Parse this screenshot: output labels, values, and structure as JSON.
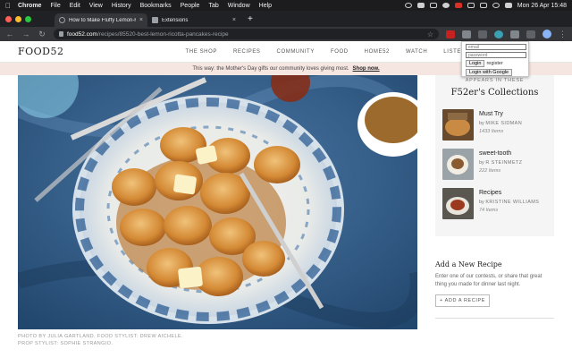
{
  "menubar": {
    "app": "Chrome",
    "items": [
      "File",
      "Edit",
      "View",
      "History",
      "Bookmarks",
      "People",
      "Tab",
      "Window",
      "Help"
    ],
    "clock": "Mon 26 Apr  15:48"
  },
  "tabs": [
    {
      "title": "How to Make Fluffy Lemon-Ric",
      "active": true
    },
    {
      "title": "Extensions",
      "active": false
    }
  ],
  "address": {
    "host": "food52.com",
    "path": "/recipes/85520-best-lemon-ricotta-pancakes-recipe"
  },
  "site": {
    "logo": "FOOD52",
    "nav": [
      "THE SHOP",
      "RECIPES",
      "COMMUNITY",
      "FOOD",
      "HOME52",
      "WATCH",
      "LISTEN"
    ]
  },
  "banner": {
    "text": "This way: the Mother's Day gifts our community loves giving most.",
    "link": "Shop now."
  },
  "photo": {
    "credit_line1": "PHOTO BY JULIA GARTLAND. FOOD STYLIST: DREW AICHELE.",
    "credit_line2": "PROP STYLIST: SOPHIE STRANGIO."
  },
  "sidebar": {
    "eyebrow": "APPEARS IN THESE",
    "title": "F52er's Collections",
    "collections": [
      {
        "name": "Must Try",
        "by_prefix": "by",
        "author": "Mike Sidman",
        "items": "1433 Items"
      },
      {
        "name": "sweet-tooth",
        "by_prefix": "by",
        "author": "R Steinmetz",
        "items": "222 Items"
      },
      {
        "name": "Recipes",
        "by_prefix": "by",
        "author": "Kristine Williams",
        "items": "74 Items"
      }
    ]
  },
  "add_recipe": {
    "title": "Add a New Recipe",
    "body": "Enter one of our contests, or share that great thing you made for dinner last night.",
    "button": "+ ADD A RECIPE"
  },
  "popup": {
    "email_placeholder": "email",
    "password_placeholder": "password",
    "login": "Login",
    "register": "register",
    "google": "Login with Google"
  }
}
